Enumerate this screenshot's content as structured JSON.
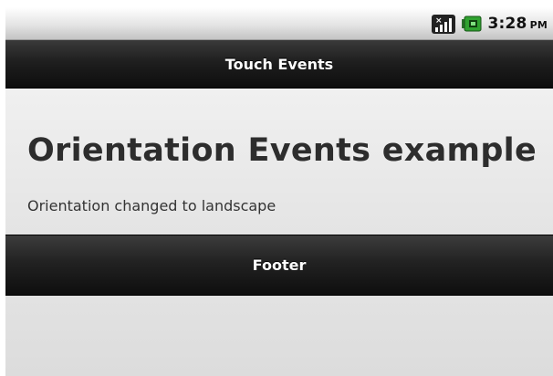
{
  "status_bar": {
    "time": "3:28",
    "ampm": "PM",
    "icons": [
      "signal-no-sim-icon",
      "battery-charging-icon"
    ]
  },
  "header": {
    "title": "Touch Events"
  },
  "content": {
    "heading": "Orientation Events example",
    "message": "Orientation changed to landscape"
  },
  "footer": {
    "title": "Footer"
  },
  "colors": {
    "bar_dark": "#1f1f1f",
    "content_bg": "#eaeaea",
    "battery_green": "#2fa12f",
    "text_dark": "#2d2d2d"
  }
}
